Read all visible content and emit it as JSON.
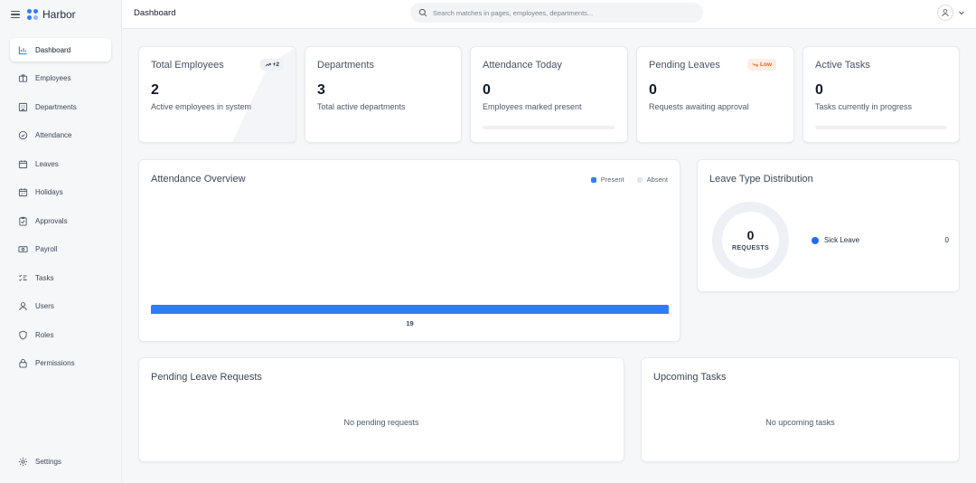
{
  "app": {
    "name": "Harbor"
  },
  "sidebar": {
    "items": [
      {
        "label": "Dashboard",
        "icon": "bar-chart-icon",
        "active": true
      },
      {
        "label": "Employees",
        "icon": "briefcase-icon"
      },
      {
        "label": "Departments",
        "icon": "building-icon"
      },
      {
        "label": "Attendance",
        "icon": "check-circle-icon"
      },
      {
        "label": "Leaves",
        "icon": "calendar-icon"
      },
      {
        "label": "Holidays",
        "icon": "calendar-grid-icon"
      },
      {
        "label": "Approvals",
        "icon": "clipboard-check-icon"
      },
      {
        "label": "Payroll",
        "icon": "banknote-icon"
      },
      {
        "label": "Tasks",
        "icon": "list-check-icon"
      },
      {
        "label": "Users",
        "icon": "user-icon"
      },
      {
        "label": "Roles",
        "icon": "shield-icon"
      },
      {
        "label": "Permissions",
        "icon": "lock-icon"
      }
    ],
    "settings_label": "Settings"
  },
  "header": {
    "title": "Dashboard",
    "search_placeholder": "Search matches in pages, employees, departments..."
  },
  "stats": [
    {
      "title": "Total Employees",
      "value": "2",
      "sub": "Active employees in system",
      "badge": "+2"
    },
    {
      "title": "Departments",
      "value": "3",
      "sub": "Total active departments"
    },
    {
      "title": "Attendance Today",
      "value": "0",
      "sub": "Employees marked present",
      "progress": 0
    },
    {
      "title": "Pending Leaves",
      "value": "0",
      "sub": "Requests awaiting approval",
      "badge": "Low"
    },
    {
      "title": "Active Tasks",
      "value": "0",
      "sub": "Tasks currently in progress",
      "progress": 0
    }
  ],
  "attendance": {
    "title": "Attendance Overview",
    "legend": [
      "Present",
      "Absent"
    ],
    "bar_label": "19"
  },
  "leave_distribution": {
    "title": "Leave Type Distribution",
    "total": "0",
    "total_label": "REQUESTS",
    "items": [
      {
        "label": "Sick Leave",
        "value": "0"
      }
    ]
  },
  "pending_requests": {
    "title": "Pending Leave Requests",
    "empty": "No pending requests"
  },
  "upcoming_tasks": {
    "title": "Upcoming Tasks",
    "empty": "No upcoming tasks"
  },
  "colors": {
    "accent": "#2f7df6",
    "warning": "#e8641b",
    "absent": "#dbe7f8"
  }
}
